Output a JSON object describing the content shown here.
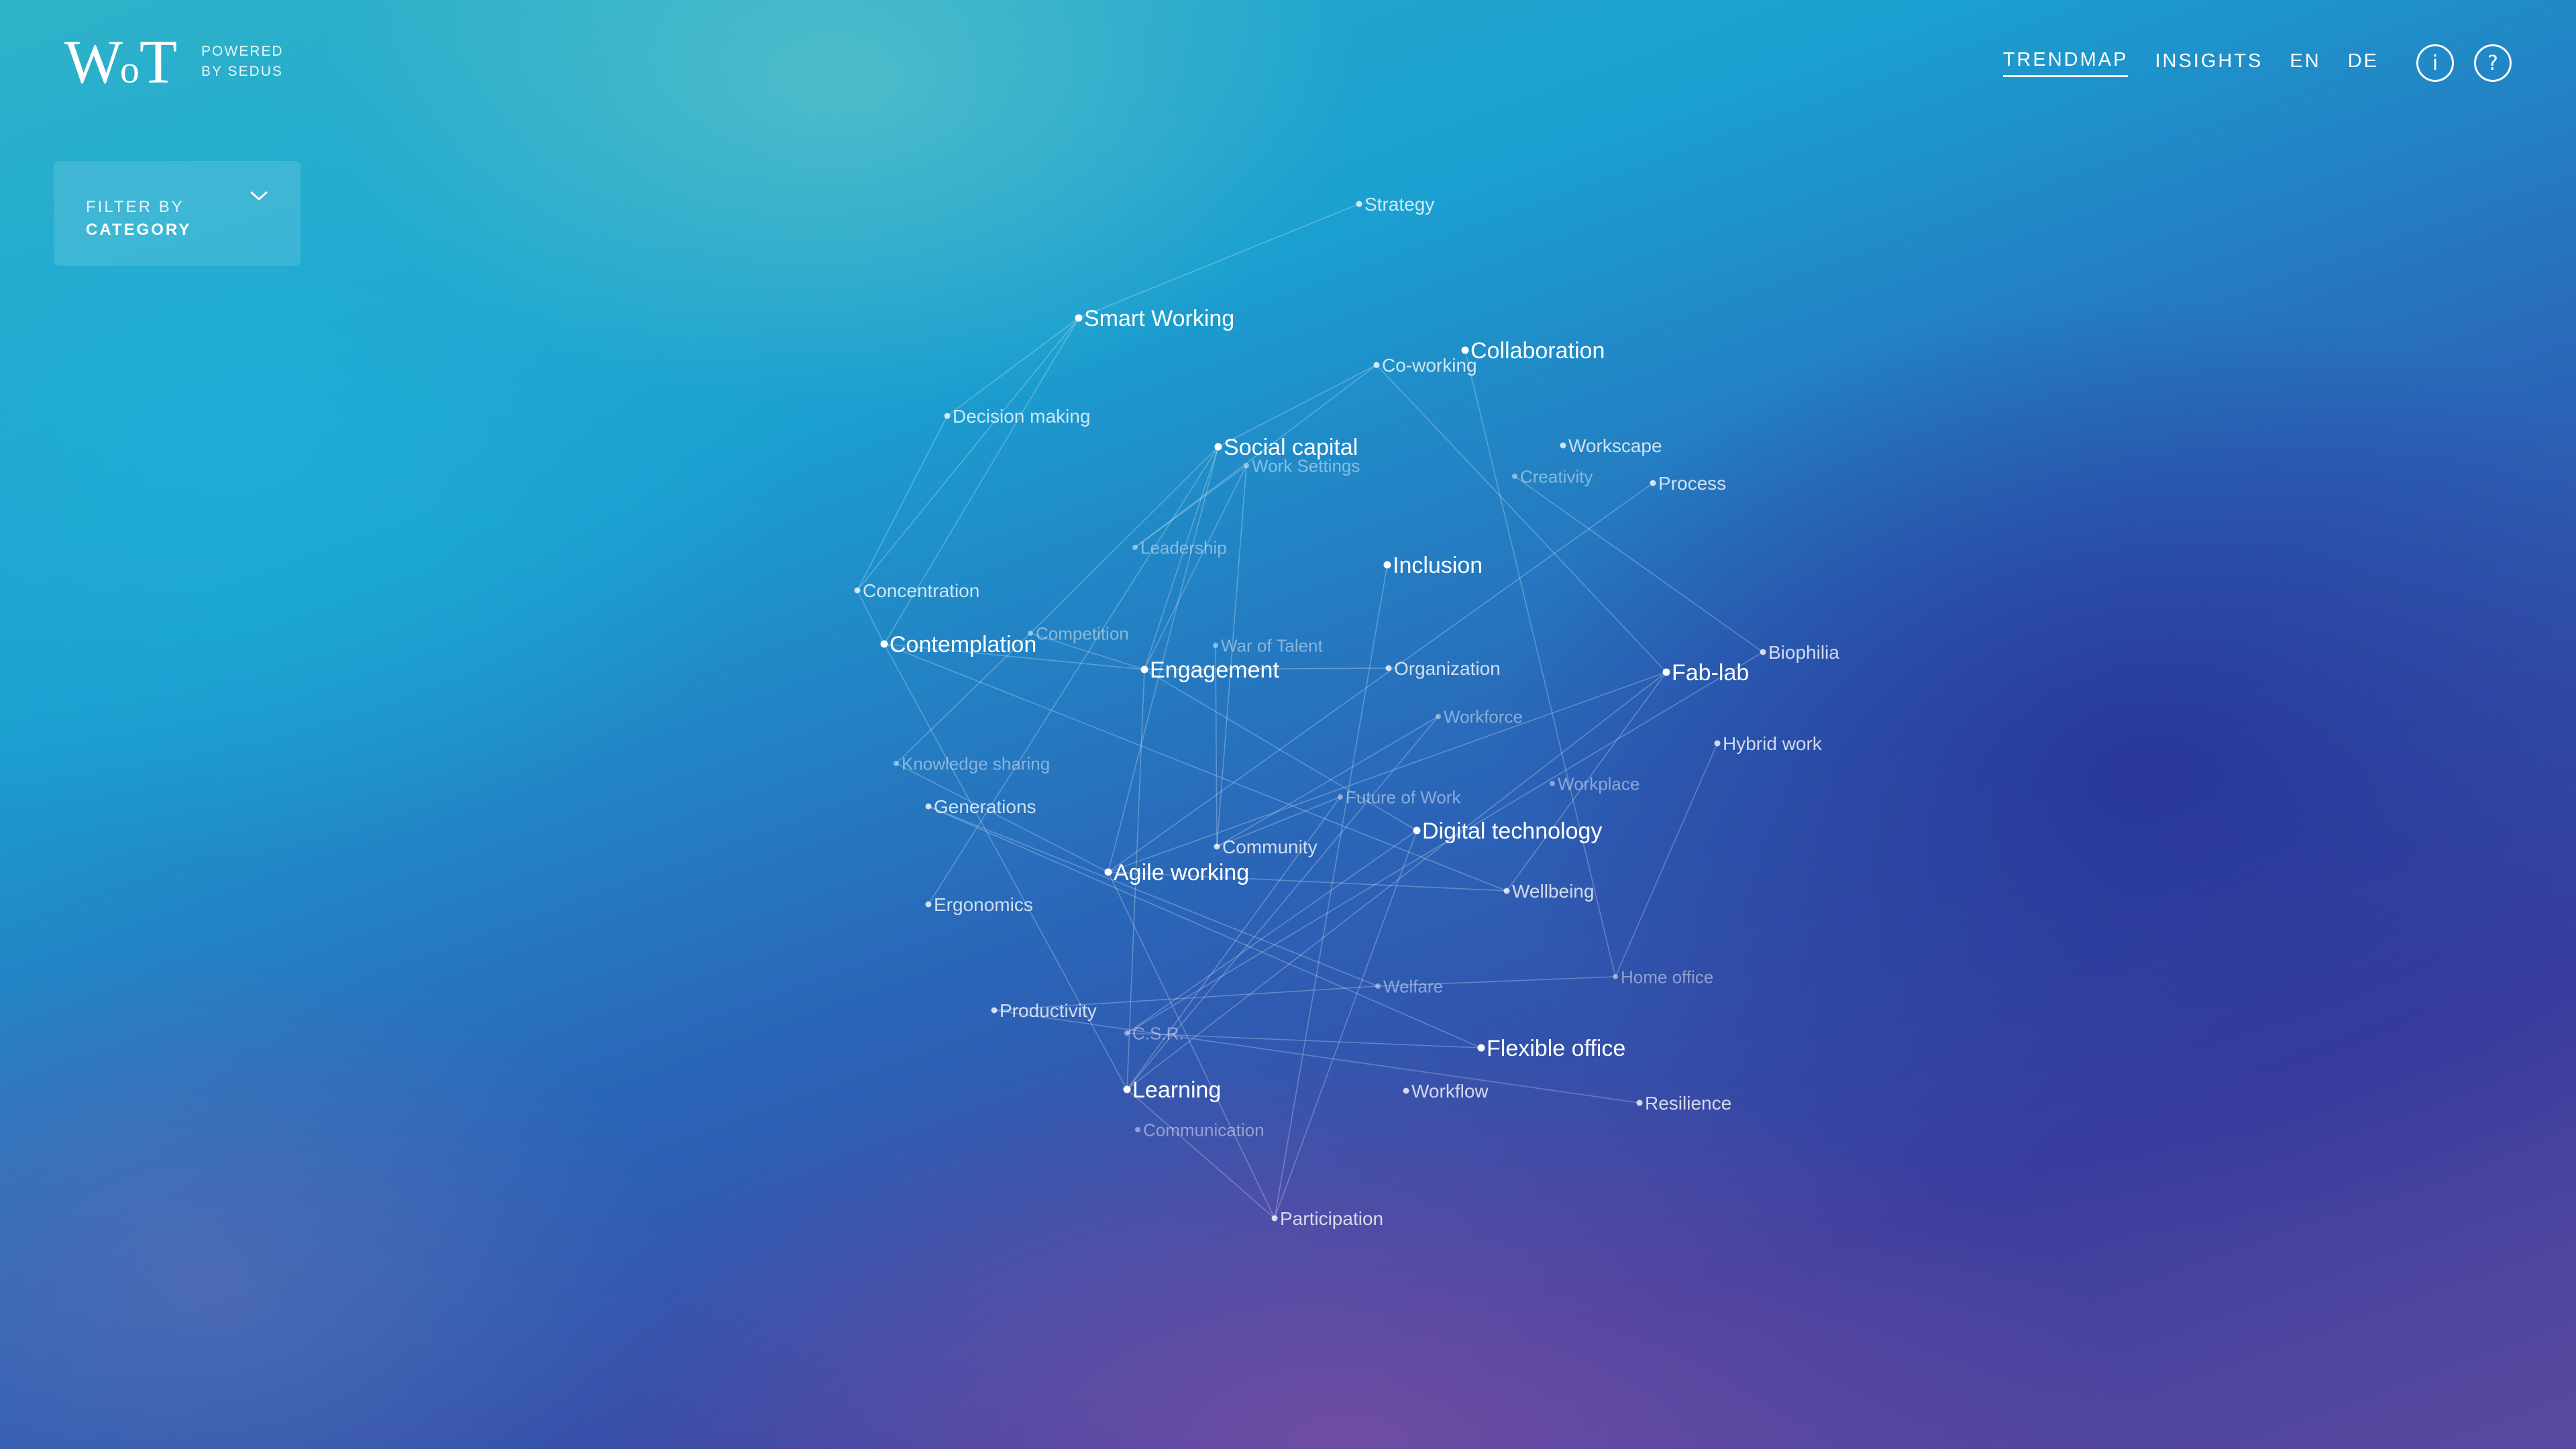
{
  "brand": {
    "logo_text": "WoT",
    "powered_line1": "POWERED",
    "powered_line2": "BY SEDUS"
  },
  "nav": {
    "links": [
      "TRENDMAP",
      "INSIGHTS",
      "EN",
      "DE"
    ],
    "active": "TRENDMAP",
    "info_icon": "info-icon",
    "help_icon": "help-icon",
    "info_glyph": "i",
    "help_glyph": "?"
  },
  "filter": {
    "line1": "FILTER BY",
    "line2": "CATEGORY",
    "icon": "chevron-down-icon"
  },
  "trendmap": {
    "nodes": [
      {
        "id": "strategy",
        "label": "Strategy",
        "level": 2
      },
      {
        "id": "smart-working",
        "label": "Smart Working",
        "level": 1
      },
      {
        "id": "collaboration",
        "label": "Collaboration",
        "level": 1
      },
      {
        "id": "co-working",
        "label": "Co-working",
        "level": 2
      },
      {
        "id": "decision-making",
        "label": "Decision making",
        "level": 2
      },
      {
        "id": "social-capital",
        "label": "Social capital",
        "level": 1
      },
      {
        "id": "work-settings",
        "label": "Work Settings",
        "level": 3
      },
      {
        "id": "workscape",
        "label": "Workscape",
        "level": 2
      },
      {
        "id": "creativity",
        "label": "Creativity",
        "level": 3
      },
      {
        "id": "process",
        "label": "Process",
        "level": 2
      },
      {
        "id": "leadership",
        "label": "Leadership",
        "level": 3
      },
      {
        "id": "inclusion",
        "label": "Inclusion",
        "level": 1
      },
      {
        "id": "concentration",
        "label": "Concentration",
        "level": 2
      },
      {
        "id": "contemplation",
        "label": "Contemplation",
        "level": 1
      },
      {
        "id": "competition",
        "label": "Competition",
        "level": 3
      },
      {
        "id": "war-of-talent",
        "label": "War of Talent",
        "level": 3
      },
      {
        "id": "engagement",
        "label": "Engagement",
        "level": 1
      },
      {
        "id": "organization",
        "label": "Organization",
        "level": 2
      },
      {
        "id": "fab-lab",
        "label": "Fab-lab",
        "level": 1
      },
      {
        "id": "biophilia",
        "label": "Biophilia",
        "level": 2
      },
      {
        "id": "workforce",
        "label": "Workforce",
        "level": 3
      },
      {
        "id": "hybrid-work",
        "label": "Hybrid work",
        "level": 2
      },
      {
        "id": "knowledge-sharing",
        "label": "Knowledge sharing",
        "level": 3
      },
      {
        "id": "workplace",
        "label": "Workplace",
        "level": 3
      },
      {
        "id": "future-of-work",
        "label": "Future of Work",
        "level": 3
      },
      {
        "id": "generations",
        "label": "Generations",
        "level": 2
      },
      {
        "id": "digital-technology",
        "label": "Digital technology",
        "level": 1
      },
      {
        "id": "community",
        "label": "Community",
        "level": 2
      },
      {
        "id": "agile-working",
        "label": "Agile working",
        "level": 1
      },
      {
        "id": "wellbeing",
        "label": "Wellbeing",
        "level": 2
      },
      {
        "id": "ergonomics",
        "label": "Ergonomics",
        "level": 2
      },
      {
        "id": "home-office",
        "label": "Home office",
        "level": 3
      },
      {
        "id": "welfare",
        "label": "Welfare",
        "level": 3
      },
      {
        "id": "productivity",
        "label": "Productivity",
        "level": 2
      },
      {
        "id": "csr",
        "label": "C.S.R.",
        "level": 3
      },
      {
        "id": "flexible-office",
        "label": "Flexible office",
        "level": 1
      },
      {
        "id": "learning",
        "label": "Learning",
        "level": 1
      },
      {
        "id": "workflow",
        "label": "Workflow",
        "level": 2
      },
      {
        "id": "resilience",
        "label": "Resilience",
        "level": 2
      },
      {
        "id": "communication",
        "label": "Communication",
        "level": 3
      },
      {
        "id": "participation",
        "label": "Participation",
        "level": 2
      }
    ]
  }
}
